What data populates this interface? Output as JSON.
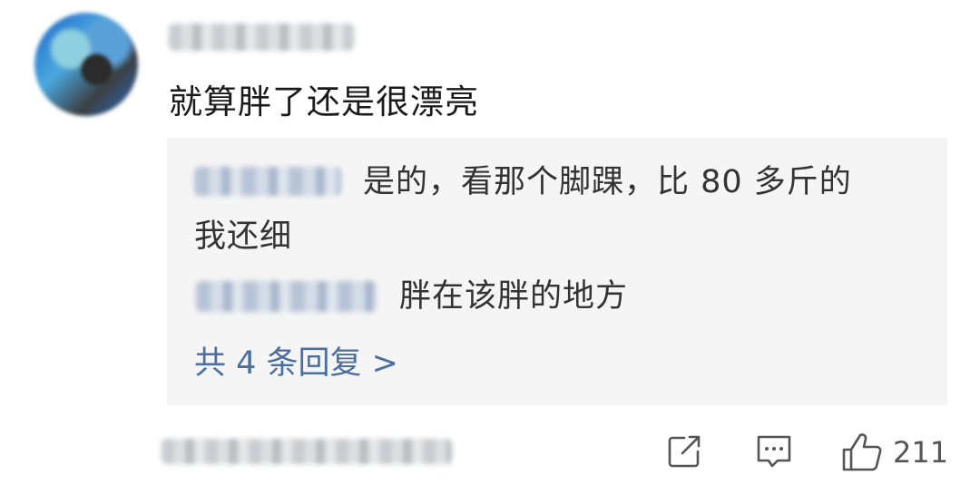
{
  "comment": {
    "text": "就算胖了还是很漂亮",
    "replies": [
      {
        "text_line1": "是的，看那个脚踝，比 80 多斤的",
        "text_line2": "我还细"
      },
      {
        "text": "胖在该胖的地方"
      }
    ],
    "more_replies_label": "共 4 条回复 >",
    "like_count": "211"
  },
  "icons": {
    "share": "share-icon",
    "reply": "comment-icon",
    "like": "thumbs-up-icon"
  },
  "colors": {
    "link": "#4a6f9e",
    "text": "#1a1a1a",
    "reply_bg": "#f5f5f5"
  }
}
